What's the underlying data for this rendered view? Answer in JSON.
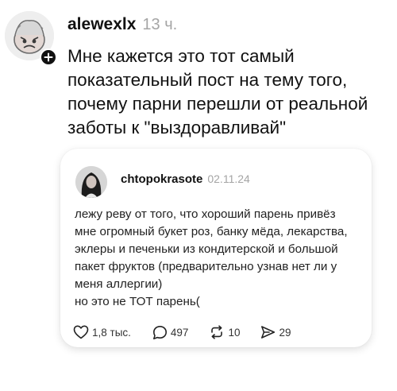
{
  "post": {
    "username": "alewexlx",
    "time": "13 ч.",
    "text_lines": [
      "Мне кажется это тот самый",
      "показательный пост на тему того,",
      "почему парни перешли от реальной",
      "заботы к \"выздоравливай\""
    ]
  },
  "quoted_post": {
    "username": "chtopokrasote",
    "date": "02.11.24",
    "text_lines": [
      "лежу реву от того, что хороший парень привёз",
      "мне огромный букет роз, банку мёда, лекарства,",
      "эклеры и печеньки из кондитерской и большой",
      "пакет фруктов (предварительно узнав нет ли у",
      "меня аллергии)",
      "но это не ТОТ парень("
    ],
    "actions": {
      "likes": "1,8 тыс.",
      "comments": "497",
      "reposts": "10",
      "shares": "29"
    }
  },
  "icons": {
    "follow": "plus-icon",
    "like": "heart-icon",
    "comment": "comment-bubble-icon",
    "repost": "repost-arrows-icon",
    "share": "send-icon"
  }
}
